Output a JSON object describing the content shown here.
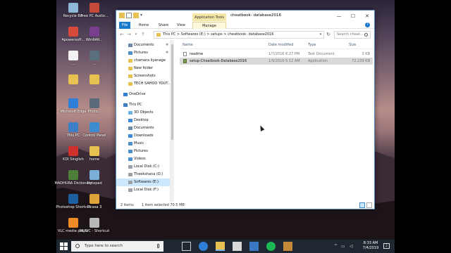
{
  "desktop": {
    "icons": [
      {
        "label": "Recycle Bin",
        "icon": "recycle-bin-icon",
        "color": "#8fb7d9"
      },
      {
        "label": "Free PC Audio...",
        "icon": "audio-app-icon",
        "color": "#c54a3a"
      },
      {
        "label": "Apowersoft...",
        "icon": "apowersoft-icon",
        "color": "#d84a3c"
      },
      {
        "label": "WinRAR...",
        "icon": "winrar-icon",
        "color": "#7a3e8f"
      },
      {
        "label": "...",
        "icon": "document-icon",
        "color": "#f3f3f3"
      },
      {
        "label": "...",
        "icon": "shortcut-icon",
        "color": "#5a6f7e"
      },
      {
        "label": "...",
        "icon": "folder-icon",
        "color": "#e8c250"
      },
      {
        "label": "...",
        "icon": "folder-icon",
        "color": "#e8c250"
      },
      {
        "label": "Microsoft Edge",
        "icon": "edge-icon",
        "color": "#2f7fd8"
      },
      {
        "label": "Photo...",
        "icon": "photo-app-icon",
        "color": "#5a6a7a"
      },
      {
        "label": "This PC",
        "icon": "this-pc-icon",
        "color": "#3d7fc6"
      },
      {
        "label": "Control Panel",
        "icon": "control-panel-icon",
        "color": "#3f8bd1"
      },
      {
        "label": "KDI Singlish",
        "icon": "singlish-app-icon",
        "color": "#d0312d"
      },
      {
        "label": "home",
        "icon": "folder-icon",
        "color": "#e8c250"
      },
      {
        "label": "MADHURA Dictionary",
        "icon": "dictionary-icon",
        "color": "#4d7f3a"
      },
      {
        "label": "Notepad",
        "icon": "notepad-icon",
        "color": "#7ab0d8"
      },
      {
        "label": "Photoshop Shortcut",
        "icon": "photoshop-icon",
        "color": "#1d5f9f"
      },
      {
        "label": "Picasa 3",
        "icon": "picasa-icon",
        "color": "#e0a33a"
      },
      {
        "label": "VLC media player",
        "icon": "vlc-icon",
        "color": "#f08a24"
      },
      {
        "label": "MUSIC - Shortcut",
        "icon": "music-shortcut-icon",
        "color": "#b8b8b8"
      }
    ]
  },
  "window": {
    "title": "cheatbook- database2016",
    "context_tab": "Application Tools",
    "ribbon_tabs": [
      "File",
      "Home",
      "Share",
      "View",
      "Manage"
    ],
    "controls": {
      "minimize": "—",
      "maximize": "☐",
      "close": "✕"
    },
    "help": "?",
    "address": {
      "crumbs": [
        "This PC",
        ">",
        "Softwares (E:)",
        ">",
        "setups",
        ">",
        "cheatbook- database2016"
      ],
      "text": "This PC  >  Softwares (E:)  >  setups  >  cheatbook- database2016"
    },
    "search_placeholder": "Search cheat...",
    "nav_pane": [
      {
        "label": "Documents",
        "icon": "documents-icon",
        "pinned": true
      },
      {
        "label": "Pictures",
        "icon": "pictures-icon",
        "pinned": true
      },
      {
        "label": "chamara liyanage",
        "icon": "folder-icon",
        "pinned": false
      },
      {
        "label": "New folder",
        "icon": "folder-icon",
        "pinned": false
      },
      {
        "label": "Screenshots",
        "icon": "folder-icon",
        "pinned": false
      },
      {
        "label": "TECH SAHOO YOUT...",
        "icon": "folder-icon",
        "pinned": false
      },
      {
        "label": "OneDrive",
        "icon": "onedrive-icon",
        "pinned": false
      },
      {
        "label": "This PC",
        "icon": "this-pc-icon",
        "pinned": false
      },
      {
        "label": "3D Objects",
        "icon": "3d-objects-icon",
        "pinned": false
      },
      {
        "label": "Desktop",
        "icon": "desktop-icon",
        "pinned": false
      },
      {
        "label": "Documents",
        "icon": "documents-icon",
        "pinned": false
      },
      {
        "label": "Downloads",
        "icon": "downloads-icon",
        "pinned": false
      },
      {
        "label": "Music",
        "icon": "music-icon",
        "pinned": false
      },
      {
        "label": "Pictures",
        "icon": "pictures-icon",
        "pinned": false
      },
      {
        "label": "Videos",
        "icon": "videos-icon",
        "pinned": false
      },
      {
        "label": "Local Disk (C:)",
        "icon": "drive-icon",
        "pinned": false
      },
      {
        "label": "Theekshana (D:)",
        "icon": "drive-icon",
        "pinned": false
      },
      {
        "label": "Softwares (E:)",
        "icon": "drive-icon",
        "pinned": false,
        "selected": true
      },
      {
        "label": "Local Disk (F:)",
        "icon": "drive-icon",
        "pinned": false
      }
    ],
    "columns": [
      "Name",
      "Date modified",
      "Type",
      "Size"
    ],
    "files": [
      {
        "name": "readme",
        "date": "1/7/2016 6:27 PM",
        "type": "Text Document",
        "size": "3 KB",
        "icon": "text-file-icon",
        "selected": false
      },
      {
        "name": "setup-Cheatbook-Database2016",
        "date": "1/9/2016 5:12 AM",
        "type": "Application",
        "size": "72,239 KB",
        "icon": "setup-app-icon",
        "selected": true
      }
    ],
    "status": {
      "count": "2 items",
      "selection": "1 item selected  70.5 MB"
    }
  },
  "taskbar": {
    "search_placeholder": "Type here to search",
    "apps": [
      "task-view-icon",
      "edge-icon",
      "file-explorer-icon",
      "store-icon",
      "mail-icon",
      "spotify-icon",
      "camera-app-icon"
    ],
    "time": "8:33 AM",
    "date": "7/4/2019"
  },
  "colors": {
    "accent": "#1979ca",
    "selection": "#cce8ff",
    "context_tab": "#f4e7a8"
  }
}
